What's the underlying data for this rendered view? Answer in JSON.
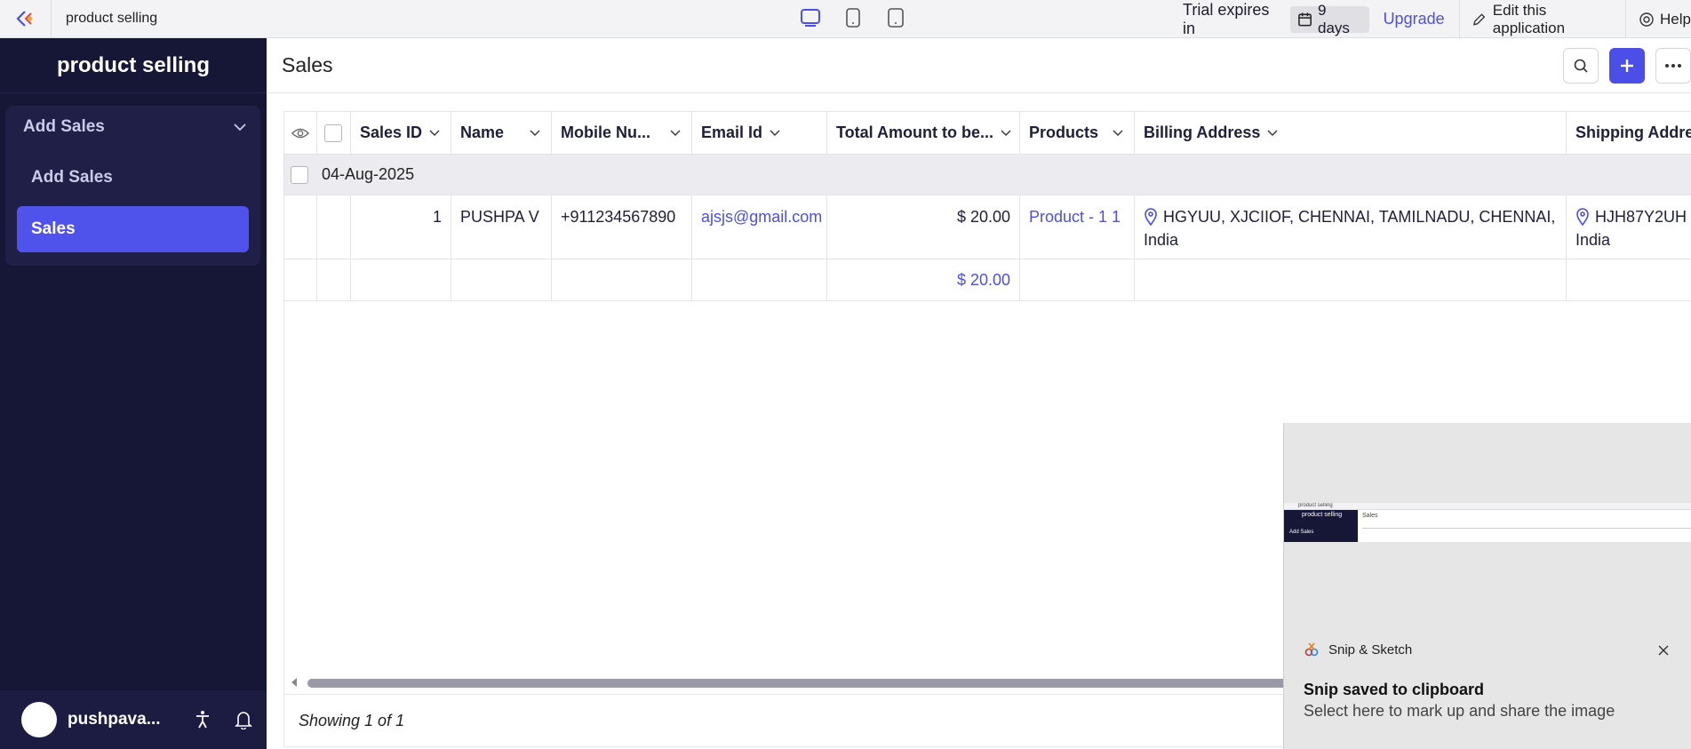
{
  "topbar": {
    "app_name": "product selling",
    "trial_label": "Trial expires in",
    "trial_days": "9 days",
    "upgrade_label": "Upgrade",
    "edit_label": "Edit this application",
    "help_label": "Help",
    "device_views": [
      "desktop-view",
      "tablet-view",
      "mobile-view"
    ]
  },
  "sidebar": {
    "title": "product selling",
    "group_label": "Add Sales",
    "items": [
      {
        "label": "Add Sales",
        "active": false
      },
      {
        "label": "Sales",
        "active": true
      }
    ],
    "user_name": "pushpava..."
  },
  "main": {
    "page_title": "Sales",
    "columns": [
      "Sales ID",
      "Name",
      "Mobile Nu...",
      "Email Id",
      "Total Amount to be...",
      "Products",
      "Billing Address",
      "Shipping Address"
    ],
    "group_label": "04-Aug-2025",
    "rows": [
      {
        "sales_id": "1",
        "name": "PUSHPA V",
        "mobile": "+911234567890",
        "email": "ajsjs@gmail.com",
        "total": "$ 20.00",
        "products": "Product - 1 1",
        "billing_line1": "HGYUU, XJCIIOF, CHENNAI, TAMILNADU, CHENNAI,",
        "billing_line2": "India",
        "shipping_line1": "HJH87Y2UH",
        "shipping_line2": "India"
      }
    ],
    "total_row": {
      "total": "$ 20.00"
    },
    "footer": "Showing 1 of 1"
  },
  "toast": {
    "app_name": "Snip & Sketch",
    "title": "Snip saved to clipboard",
    "body": "Select here to mark up and share the image",
    "thumb_app": "product selling",
    "thumb_page": "Sales",
    "thumb_group": "Add Sales"
  },
  "colors": {
    "accent": "#4b4fe8",
    "sidebar_bg": "#161637",
    "active_item": "#5052ec"
  }
}
